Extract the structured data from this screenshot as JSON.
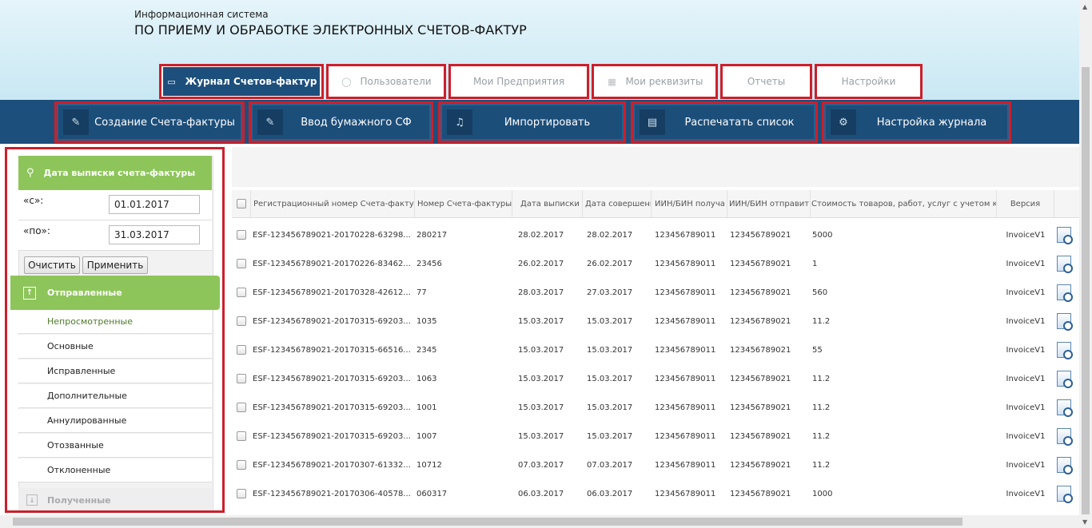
{
  "header": {
    "system_subtitle": "Информационная система",
    "system_title": "ПО ПРИЕМУ И ОБРАБОТКЕ ЭЛЕКТРОННЫХ СЧЕТОВ-ФАКТУР"
  },
  "tabs": [
    {
      "label": "Журнал Счетов-фактур",
      "icon": "monitor-icon",
      "active": true
    },
    {
      "label": "Пользователи",
      "icon": "user-icon"
    },
    {
      "label": "Мои Предприятия",
      "icon": ""
    },
    {
      "label": "Мои реквизиты",
      "icon": "table-icon"
    },
    {
      "label": "Отчеты",
      "icon": ""
    },
    {
      "label": "Настройки",
      "icon": ""
    }
  ],
  "toolbar": [
    {
      "label": "Создание Счета-фактуры",
      "icon": "edit-icon"
    },
    {
      "label": "Ввод бумажного СФ",
      "icon": "edit-icon"
    },
    {
      "label": "Импортировать",
      "icon": "import-icon"
    },
    {
      "label": "Распечатать список",
      "icon": "print-icon"
    },
    {
      "label": "Настройка журнала",
      "icon": "gear-icon"
    }
  ],
  "filter": {
    "title": "Дата выписки счета-фактуры",
    "from_label": "«с»:",
    "from_value": "01.01.2017",
    "to_label": "«по»:",
    "to_value": "31.03.2017",
    "clear_label": "Очистить",
    "apply_label": "Применить"
  },
  "sent_group": {
    "title": "Отправленные",
    "items": [
      "Непросмотренные",
      "Основные",
      "Исправленные",
      "Дополнительные",
      "Аннулированные",
      "Отозванные",
      "Отклоненные"
    ]
  },
  "received_group": {
    "title": "Полученные"
  },
  "table": {
    "columns": [
      "Регистрационный номер Счета-фактур",
      "Номер Счета-фактуры",
      "Дата выписки",
      "Дата совершени",
      "ИИН/БИН получа",
      "ИИН/БИН отправит",
      "Стоимость товаров, работ, услуг с учетом кс",
      "Версия"
    ],
    "rows": [
      [
        "ESF-123456789021-20170228-63298...",
        "280217",
        "28.02.2017",
        "28.02.2017",
        "123456789011",
        "123456789021",
        "5000",
        "InvoiceV1"
      ],
      [
        "ESF-123456789021-20170226-83462...",
        "23456",
        "26.02.2017",
        "26.02.2017",
        "123456789011",
        "123456789021",
        "1",
        "InvoiceV1"
      ],
      [
        "ESF-123456789021-20170328-42612...",
        "77",
        "28.03.2017",
        "27.03.2017",
        "123456789011",
        "123456789021",
        "560",
        "InvoiceV1"
      ],
      [
        "ESF-123456789021-20170315-69203...",
        "1035",
        "15.03.2017",
        "15.03.2017",
        "123456789011",
        "123456789021",
        "11.2",
        "InvoiceV1"
      ],
      [
        "ESF-123456789021-20170315-66516...",
        "2345",
        "15.03.2017",
        "15.03.2017",
        "123456789011",
        "123456789021",
        "55",
        "InvoiceV1"
      ],
      [
        "ESF-123456789021-20170315-69203...",
        "1063",
        "15.03.2017",
        "15.03.2017",
        "123456789011",
        "123456789021",
        "11.2",
        "InvoiceV1"
      ],
      [
        "ESF-123456789021-20170315-69203...",
        "1001",
        "15.03.2017",
        "15.03.2017",
        "123456789011",
        "123456789021",
        "11.2",
        "InvoiceV1"
      ],
      [
        "ESF-123456789021-20170315-69203...",
        "1007",
        "15.03.2017",
        "15.03.2017",
        "123456789011",
        "123456789021",
        "11.2",
        "InvoiceV1"
      ],
      [
        "ESF-123456789021-20170307-61332...",
        "10712",
        "07.03.2017",
        "07.03.2017",
        "123456789011",
        "123456789021",
        "11.2",
        "InvoiceV1"
      ],
      [
        "ESF-123456789021-20170306-40578...",
        "060317",
        "06.03.2017",
        "06.03.2017",
        "123456789011",
        "123456789021",
        "1000",
        "InvoiceV1"
      ]
    ]
  },
  "colors": {
    "accent_blue": "#1d4f7c",
    "highlight_red": "#cc1f2a",
    "green": "#8dc55a"
  }
}
